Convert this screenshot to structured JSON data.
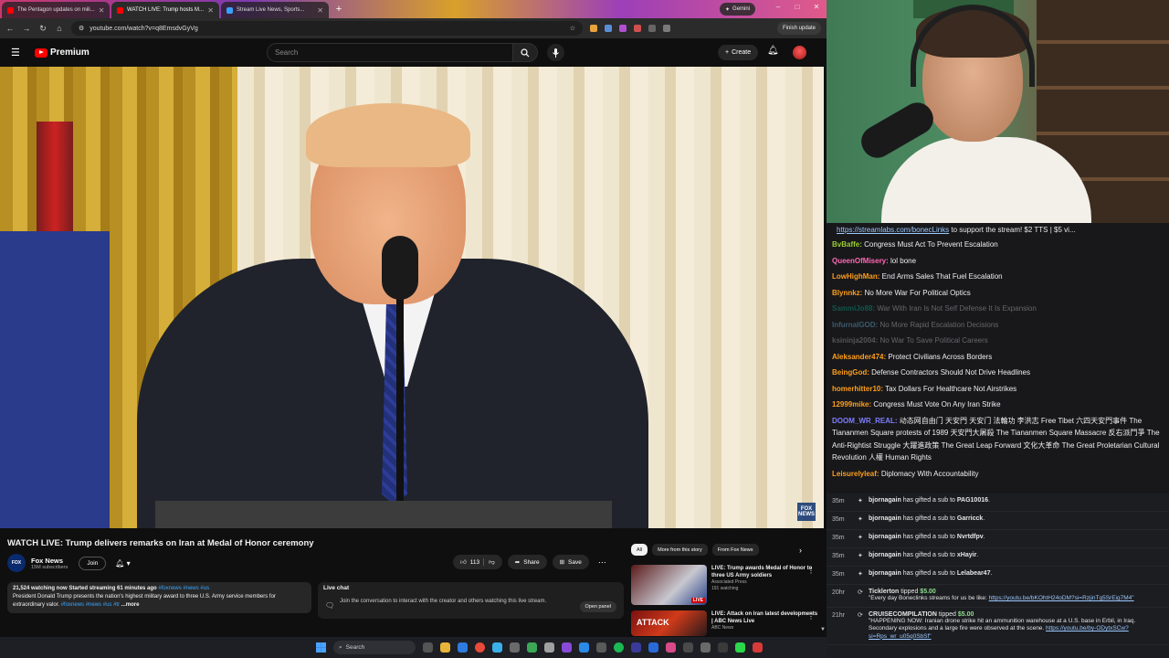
{
  "browser": {
    "tabs": [
      {
        "title": "The Pentagon updates on mili...",
        "active": false
      },
      {
        "title": "WATCH LIVE: Trump hosts M...",
        "active": true
      },
      {
        "title": "Stream Live News, Sports...",
        "active": false
      }
    ],
    "gemini_label": "Gemini",
    "url": "youtube.com/watch?v=q8EmsdvGyVg",
    "finish_update": "Finish update"
  },
  "youtube": {
    "logo": "Premium",
    "search_placeholder": "Search",
    "create_label": "Create",
    "video_title": "WATCH LIVE: Trump delivers remarks on Iran at Medal of Honor ceremony",
    "channel_name": "Fox News",
    "subscribers": "15M subscribers",
    "join_label": "Join",
    "likes": "113",
    "share_label": "Share",
    "save_label": "Save",
    "fox_bug": "FOX NEWS",
    "description": {
      "stats": "21,524 watching now  Started streaming 61 minutes ago",
      "tags": "#foxnews #news #us",
      "text": "President Donald Trump presents the nation's highest military award to three U.S. Army service members for extraordinary valor.",
      "tags2": "#foxnews #news #us #tr",
      "more": "...more"
    },
    "live_chat": {
      "title": "Live chat",
      "text": "Join the conversation to interact with the creator and others watching this live stream.",
      "open_panel": "Open panel"
    },
    "chips": [
      "All",
      "More from this story",
      "From Fox News"
    ],
    "recommended": [
      {
        "title": "LIVE: Trump awards Medal of Honor to three US Army soldiers",
        "channel": "Associated Press",
        "meta": "191 watching",
        "badge": "LIVE"
      },
      {
        "title": "LIVE: Attack on Iran latest developments | ABC News Live",
        "channel": "ABC News",
        "meta": "",
        "badge": ""
      }
    ]
  },
  "taskbar": {
    "search_label": "Search"
  },
  "stream": {
    "ticker_link": "https://streamlabs.com/bonecLinks",
    "ticker_text": " to support the stream! $2 TTS | $5 vi...",
    "chat": [
      {
        "user": "BvBaffe:",
        "color": "#9acd32",
        "msg": "Congress Must Act To Prevent Escalation",
        "faded": false
      },
      {
        "user": "QueenOfMisery:",
        "color": "#ff69b4",
        "msg": "lol bone",
        "faded": false
      },
      {
        "user": "LowHighMan:",
        "color": "#ff9f1a",
        "msg": "End Arms Sales That Fuel Escalation",
        "faded": false
      },
      {
        "user": "Blynnkz:",
        "color": "#ff9f1a",
        "msg": "No More War For Political Optics",
        "faded": false
      },
      {
        "user": "SammiJo88:",
        "color": "#00c8a0",
        "msg": "War With Iran Is Not Self Defense It Is Expansion",
        "faded": true
      },
      {
        "user": "InfurnalGOD:",
        "color": "#7fd3ff",
        "msg": "No More Rapid Escalation Decisions",
        "faded": true
      },
      {
        "user": "ksininja2004:",
        "color": "#c0c0c0",
        "msg": "No War To Save Political Careers",
        "faded": true
      },
      {
        "user": "Aleksander474:",
        "color": "#ff9f1a",
        "msg": "Protect Civilians Across Borders",
        "faded": false
      },
      {
        "user": "BeingGod:",
        "color": "#ff9f1a",
        "msg": "Defense Contractors Should Not Drive Headlines",
        "faded": false
      },
      {
        "user": "homerhitter10:",
        "color": "#ff9f1a",
        "msg": "Tax Dollars For Healthcare Not Airstrikes",
        "faded": false
      },
      {
        "user": "12999mike:",
        "color": "#ff9f1a",
        "msg": "Congress Must Vote On Any Iran Strike",
        "faded": false
      },
      {
        "user": "DOOM_WR_REAL:",
        "color": "#7f7fff",
        "msg": "动态网自由门 天安門 天安门 法輪功 李洪志 Free Tibet 六四天安門事件 The Tiananmen Square protests of 1989 天安門大屠殺 The Tiananmen Square Massacre 反右派鬥爭 The Anti-Rightist Struggle 大躍進政策 The Great Leap Forward 文化大革命 The Great Proletarian Cultural Revolution 人權 Human Rights",
        "faded": false
      },
      {
        "user": "Leisurelyleaf:",
        "color": "#ff9f1a",
        "msg": "Diplomacy With Accountability",
        "faded": false
      }
    ],
    "alerts": [
      {
        "time": "35m",
        "who": "bjornagain",
        "text": " has gifted a sub to ",
        "target": "PAG10016",
        "amount": "",
        "msg": ""
      },
      {
        "time": "35m",
        "who": "bjornagain",
        "text": " has gifted a sub to ",
        "target": "Garricck",
        "amount": "",
        "msg": ""
      },
      {
        "time": "35m",
        "who": "bjornagain",
        "text": " has gifted a sub to ",
        "target": "Nvrtdfpv",
        "amount": "",
        "msg": ""
      },
      {
        "time": "35m",
        "who": "bjornagain",
        "text": " has gifted a sub to ",
        "target": "xHayir",
        "amount": "",
        "msg": ""
      },
      {
        "time": "35m",
        "who": "bjornagain",
        "text": " has gifted a sub to ",
        "target": "Lelabear47",
        "amount": "",
        "msg": ""
      },
      {
        "time": "20hr",
        "who": "Ticklerton",
        "text": " tipped ",
        "target": "",
        "amount": "$5.00",
        "msg": "\"Every day Boneclinks streams for us be like: ",
        "link": "https://youtu.be/bKOhtH24oDM?si=RzjinTg5SrEig7M4\""
      },
      {
        "time": "21hr",
        "who": "CRUISECOMPILATION",
        "text": " tipped ",
        "target": "",
        "amount": "$5.00",
        "msg": "\"HAPPENING NOW: Iranian drone strike hit an ammunition warehouse at a U.S. base in Erbil, in Iraq. Secondary explosions and a large fire were observed at the scene. ",
        "link": "https://youtu.be/by-ODytxSCw?si=Rps_wr_u05q0SbSf\""
      }
    ],
    "accent": "#ff9f1a"
  }
}
